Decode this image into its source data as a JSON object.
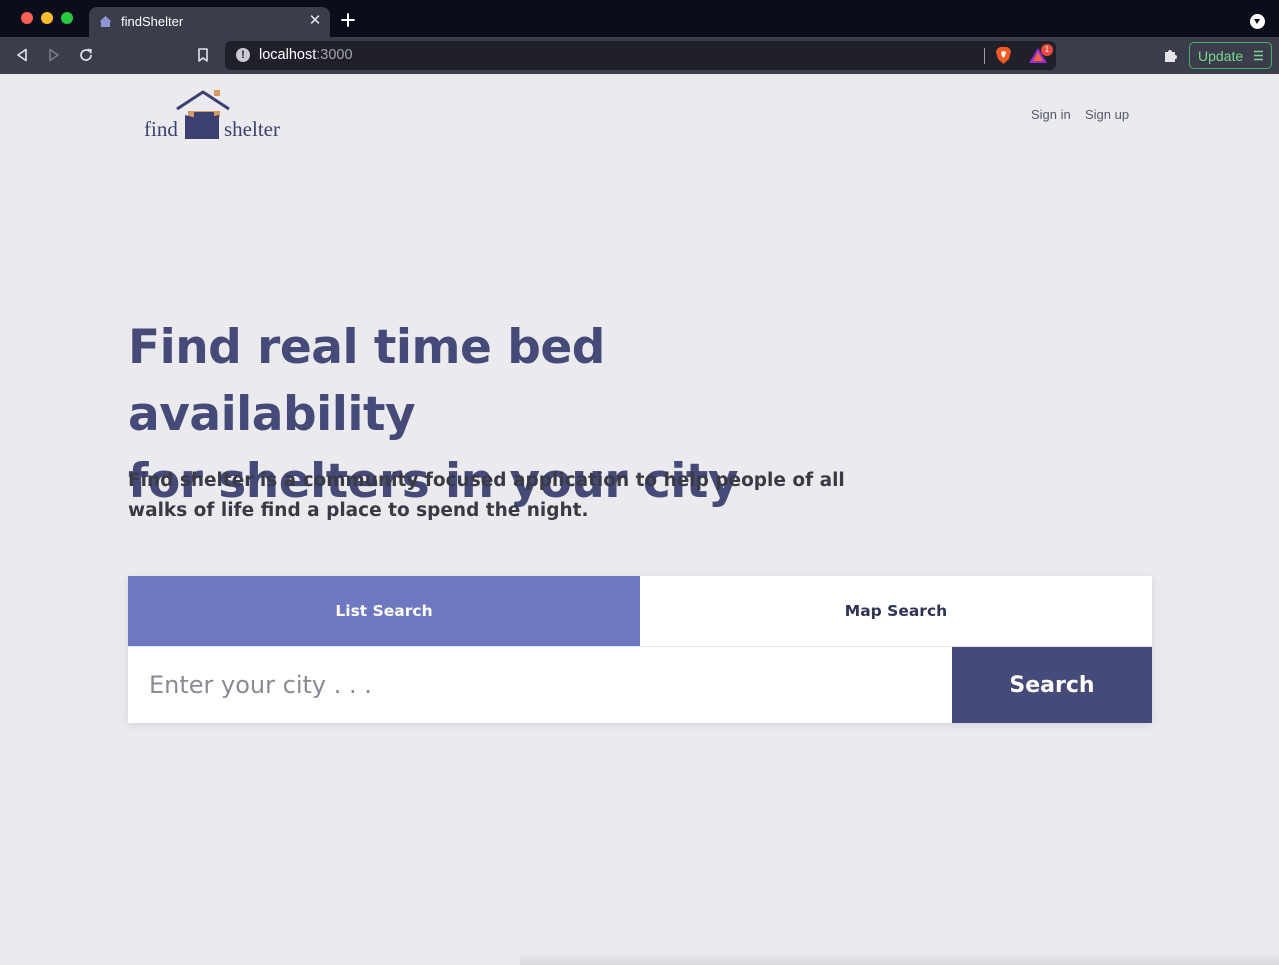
{
  "browser": {
    "tab": {
      "title": "findShelter",
      "favicon": "house-icon",
      "close_icon": "close-icon"
    },
    "new_tab_icon": "plus-icon",
    "address": {
      "host": "localhost",
      "port": ":3000"
    },
    "update_label": "Update",
    "rewards_badge": "1"
  },
  "header": {
    "logo_find": "find",
    "logo_shelter": "shelter",
    "sign_in": "Sign in",
    "sign_up": "Sign up"
  },
  "hero": {
    "title_line1": "Find real time bed availability",
    "title_line2": "for shelters in your city",
    "description": "Find shelter is a community focused application to help people of all walks of life find a place to spend the night."
  },
  "search": {
    "tab_list": "List Search",
    "tab_map": "Map Search",
    "active_tab": "List Search",
    "input_value": "",
    "placeholder": "Enter your city . . .",
    "button_label": "Search"
  },
  "colors": {
    "brand": "#454a78",
    "active_tab": "#6e78c0",
    "logo_accent": "#d49a64",
    "update_green": "#46b06a"
  }
}
